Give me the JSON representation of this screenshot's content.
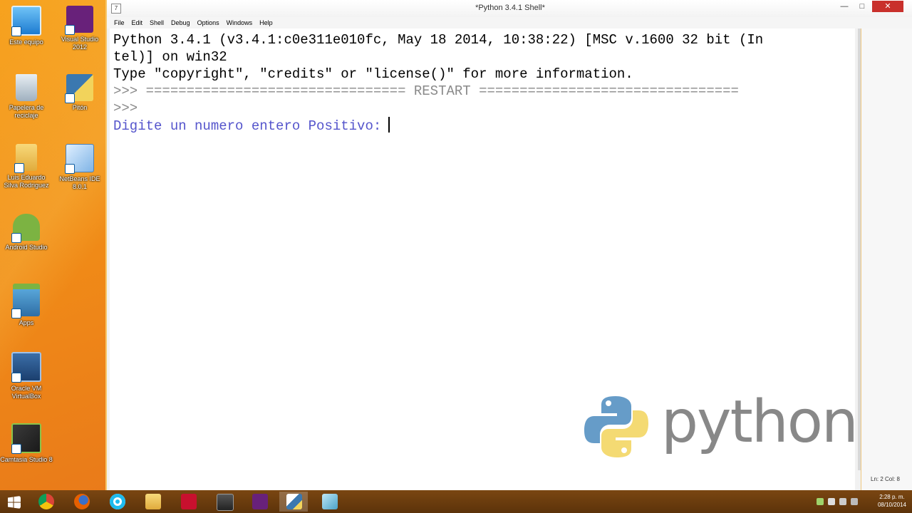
{
  "window": {
    "title": "*Python 3.4.1 Shell*",
    "icon_label": "7"
  },
  "menu": [
    "File",
    "Edit",
    "Shell",
    "Debug",
    "Options",
    "Windows",
    "Help"
  ],
  "shell": {
    "banner1": "Python 3.4.1 (v3.4.1:c0e311e010fc, May 18 2014, 10:38:22) [MSC v.1600 32 bit (In",
    "banner1_overflow": "\")",
    "banner2": "tel)] on win32",
    "banner3": "Type \"copyright\", \"credits\" or \"license()\" for more information.",
    "restart_prompt": ">>> ",
    "restart_text": "================================ RESTART ================================",
    "prompt2": ">>>",
    "input_prompt": "Digite un numero entero Positivo:"
  },
  "status": {
    "position": "Ln: 2 Col: 8"
  },
  "watermark": {
    "word": "python"
  },
  "desktop_icons": [
    {
      "label": "Este equipo",
      "icon": "computer-icon"
    },
    {
      "label": "Visual Studio 2012",
      "icon": "visual-studio-icon"
    },
    {
      "label": "Papelera de reciclaje",
      "icon": "recycle-bin-icon"
    },
    {
      "label": "Pitón",
      "icon": "python-shortcut-icon"
    },
    {
      "label": "Luis Eduardo Silva Rodriguez",
      "icon": "user-folder-icon"
    },
    {
      "label": "NetBeans IDE 8.0.1",
      "icon": "netbeans-icon"
    },
    {
      "label": "Android Studio",
      "icon": "android-icon"
    },
    {
      "label": "Apps",
      "icon": "apps-icon"
    },
    {
      "label": "Oracle VM VirtualBox",
      "icon": "virtualbox-icon"
    },
    {
      "label": "Camtasia Studio 8",
      "icon": "camtasia-icon"
    }
  ],
  "taskbar": {
    "clock_time": "2:28 p. m.",
    "clock_date": "08/10/2014",
    "apps": [
      "chrome-icon",
      "firefox-icon",
      "ie-icon",
      "file-explorer-icon",
      "adobe-icon",
      "media-icon",
      "visual-studio-icon",
      "python-idle-icon",
      "unknown-app-icon"
    ]
  },
  "colors": {
    "desktop": "#f08a17",
    "taskbar": "#6a3c0e",
    "close_button": "#c9302c",
    "prompt_gray": "#8a8a8a",
    "input_blue": "#5555cc"
  }
}
